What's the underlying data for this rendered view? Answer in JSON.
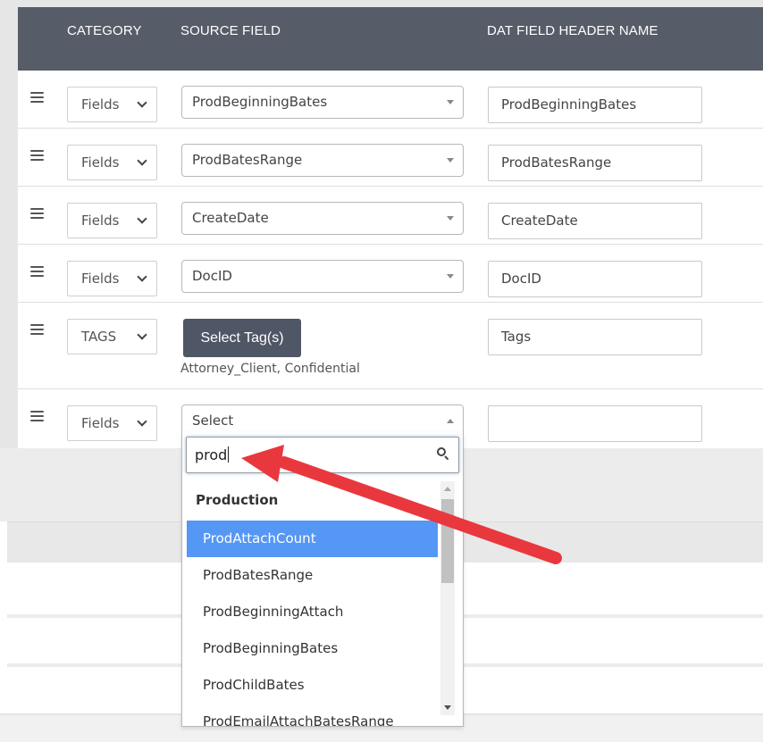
{
  "table": {
    "headers": {
      "category": "CATEGORY",
      "source_field": "SOURCE FIELD",
      "dat_header": "DAT FIELD HEADER NAME"
    },
    "rows": [
      {
        "category": "Fields",
        "source": "ProdBeginningBates",
        "dat": "ProdBeginningBates"
      },
      {
        "category": "Fields",
        "source": "ProdBatesRange",
        "dat": "ProdBatesRange"
      },
      {
        "category": "Fields",
        "source": "CreateDate",
        "dat": "CreateDate"
      },
      {
        "category": "Fields",
        "source": "DocID",
        "dat": "DocID"
      },
      {
        "category": "TAGS",
        "button": "Select Tag(s)",
        "tags": "Attorney_Client, Confidential",
        "dat": "Tags"
      },
      {
        "category": "Fields",
        "source": "Select",
        "dat": ""
      }
    ]
  },
  "dropdown": {
    "search_value": "prod",
    "group": "Production",
    "options": [
      "ProdAttachCount",
      "ProdBatesRange",
      "ProdBeginningAttach",
      "ProdBeginningBates",
      "ProdChildBates",
      "ProdEmailAttachBatesRange"
    ],
    "highlighted_index": 0
  },
  "icons": {
    "drag_handle": "drag-handle-icon",
    "chevron": "chevron-down-icon",
    "caret": "caret-icon",
    "search": "search-icon"
  },
  "colors": {
    "header_bg": "#565c68",
    "button_bg": "#4f5665",
    "highlight": "#5597f4",
    "arrow": "#e8383d"
  }
}
